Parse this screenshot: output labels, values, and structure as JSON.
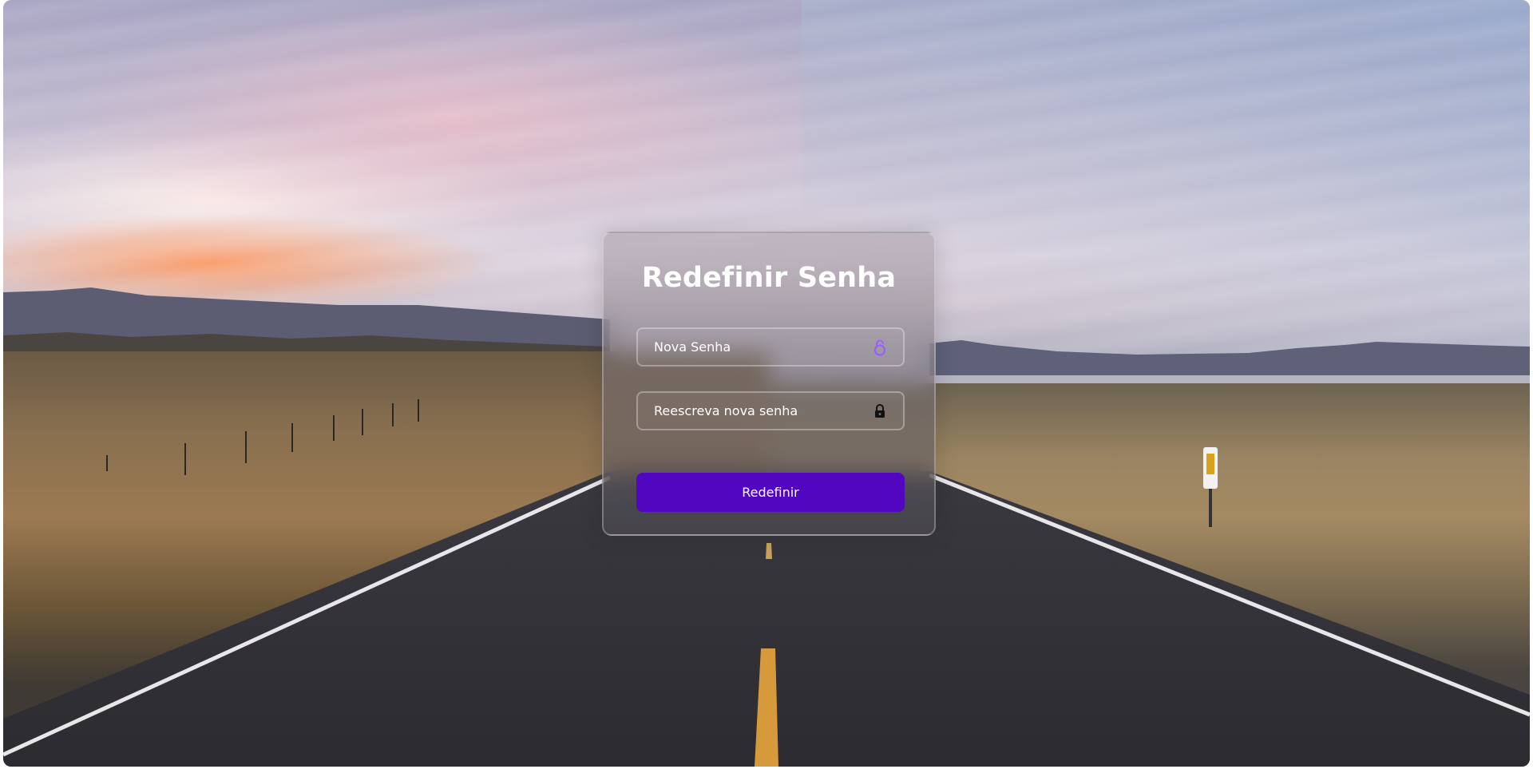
{
  "form": {
    "title": "Redefinir Senha",
    "new_password": {
      "placeholder": "Nova Senha",
      "value": "",
      "icon": "lock-open-icon",
      "icon_color": "#9b5cff"
    },
    "confirm_password": {
      "placeholder": "Reescreva nova senha",
      "value": "",
      "icon": "lock-icon",
      "icon_color": "#111111"
    },
    "submit_label": "Redefinir",
    "accent_color": "#5106c0"
  }
}
